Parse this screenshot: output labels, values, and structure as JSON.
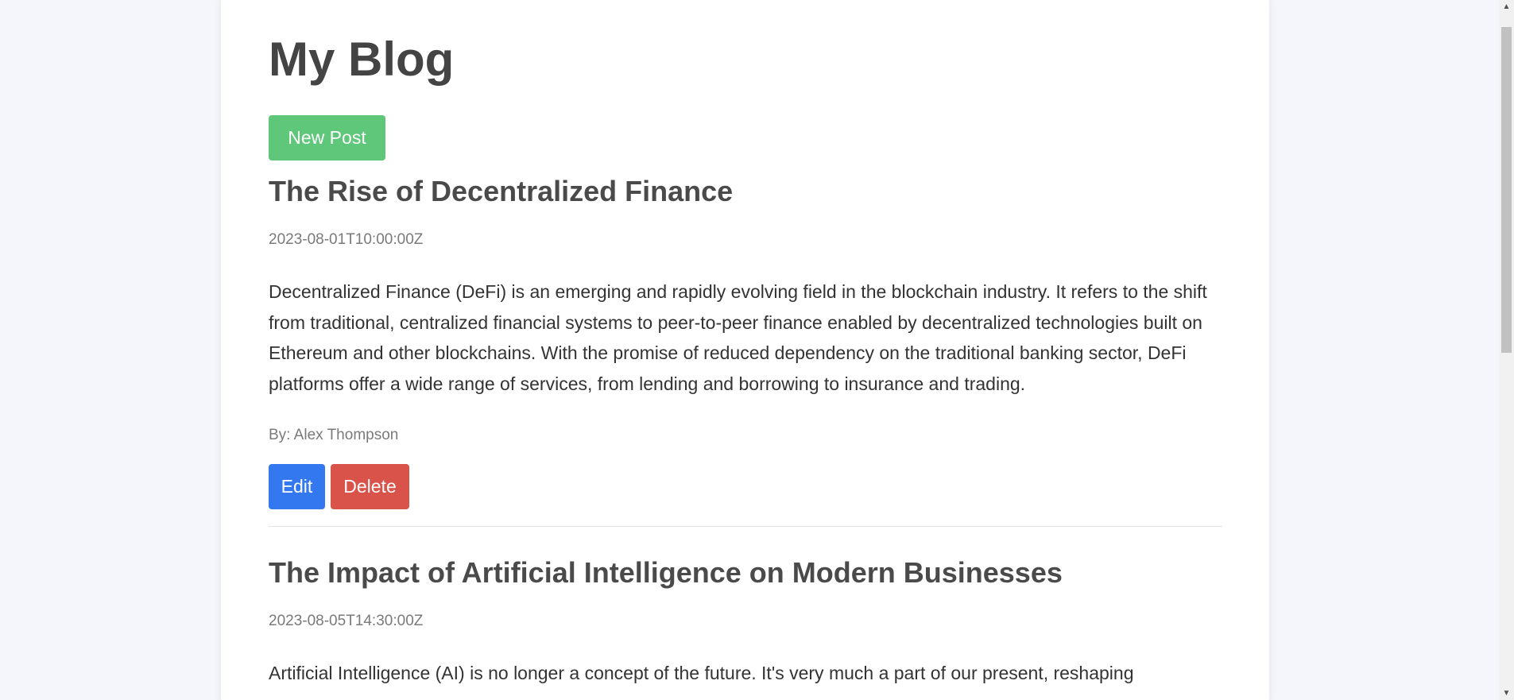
{
  "header": {
    "title": "My Blog",
    "new_post_label": "New Post"
  },
  "posts": [
    {
      "title": "The Rise of Decentralized Finance",
      "date": "2023-08-01T10:00:00Z",
      "body": "Decentralized Finance (DeFi) is an emerging and rapidly evolving field in the blockchain industry. It refers to the shift from traditional, centralized financial systems to peer-to-peer finance enabled by decentralized technologies built on Ethereum and other blockchains. With the promise of reduced dependency on the traditional banking sector, DeFi platforms offer a wide range of services, from lending and borrowing to insurance and trading.",
      "author": "By: Alex Thompson",
      "edit_label": "Edit",
      "delete_label": "Delete"
    },
    {
      "title": "The Impact of Artificial Intelligence on Modern Businesses",
      "date": "2023-08-05T14:30:00Z",
      "body": "Artificial Intelligence (AI) is no longer a concept of the future. It's very much a part of our present, reshaping"
    }
  ],
  "colors": {
    "background": "#f4f6fb",
    "new_post": "#5ec779",
    "edit": "#3478f0",
    "delete": "#d9534a"
  },
  "icons": {
    "scroll_up": "triangle-up-icon",
    "scroll_down": "triangle-down-icon"
  }
}
